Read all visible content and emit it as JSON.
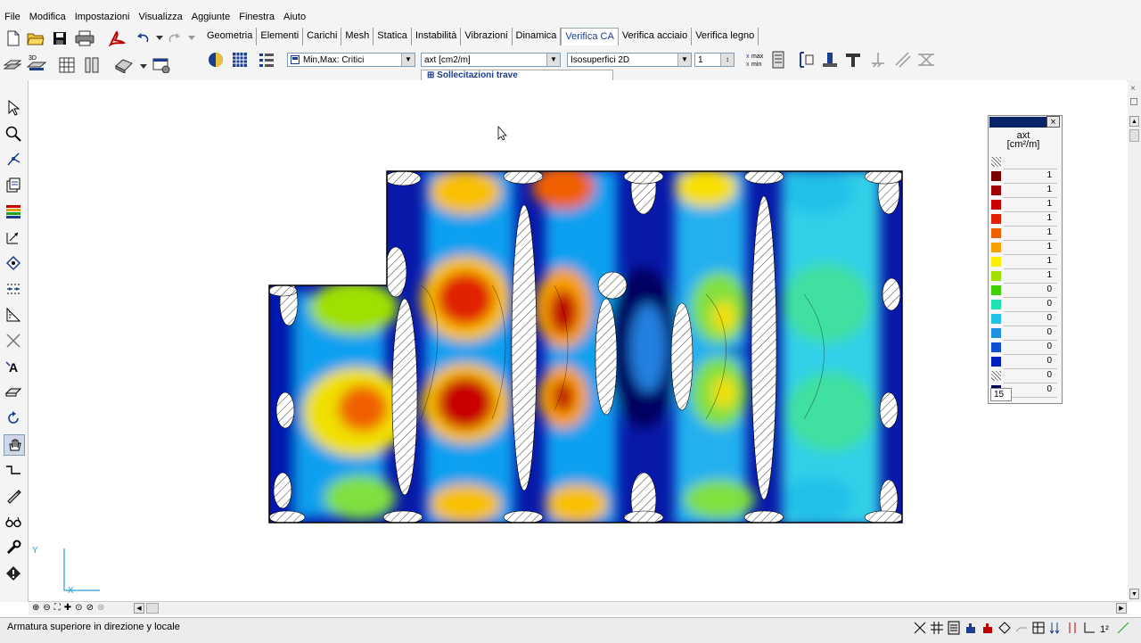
{
  "menu": [
    "File",
    "Modifica",
    "Impostazioni",
    "Visualizza",
    "Aggiunte",
    "Finestra",
    "Aiuto"
  ],
  "tabs": [
    {
      "label": "Geometria",
      "active": false
    },
    {
      "label": "Elementi",
      "active": false
    },
    {
      "label": "Carichi",
      "active": false
    },
    {
      "label": "Mesh",
      "active": false
    },
    {
      "label": "Statica",
      "active": false
    },
    {
      "label": "Instabilità",
      "active": false
    },
    {
      "label": "Vibrazioni",
      "active": false
    },
    {
      "label": "Dinamica",
      "active": false
    },
    {
      "label": "Verifica CA",
      "active": true
    },
    {
      "label": "Verifica acciaio",
      "active": false
    },
    {
      "label": "Verifica legno",
      "active": false
    }
  ],
  "combos": {
    "minmax": "Min,Max: Critici",
    "quantity": "axt [cm2/m]",
    "display": "Isosuperfici 2D",
    "step": "1"
  },
  "tree_hint": "Sollecitazioni trave",
  "maxmin_label_top": "max",
  "maxmin_label_bottom": "min",
  "legend": {
    "title": "axt",
    "unit": "[cm²/m]",
    "values": [
      "1",
      "1",
      "1",
      "1",
      "1",
      "1",
      "1",
      "1",
      "0",
      "0",
      "0",
      "0",
      "0",
      "0",
      "0",
      "0"
    ],
    "colors": [
      "#7a0000",
      "#a00000",
      "#c80000",
      "#e02000",
      "#f06000",
      "#f8a000",
      "#f8f000",
      "#a0e000",
      "#40d000",
      "#20e0b0",
      "#20c0e8",
      "#2090e0",
      "#1050d0",
      "#0020c0",
      "#001090",
      "#000060"
    ],
    "count": "15"
  },
  "axes": {
    "x": "X",
    "y": "Y"
  },
  "status": "Armatura superiore in direzione y locale"
}
